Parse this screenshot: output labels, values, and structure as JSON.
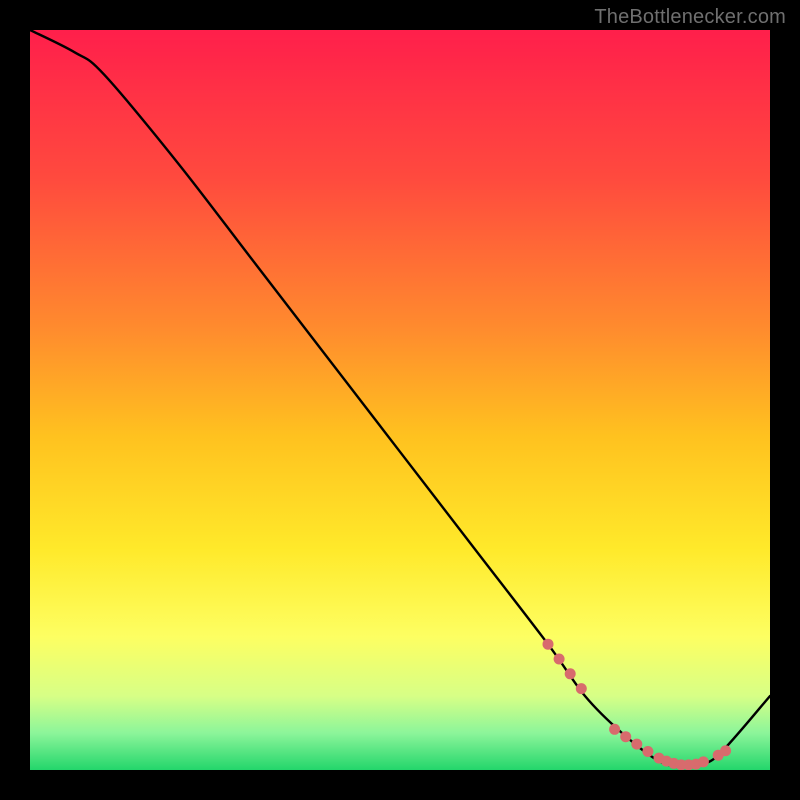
{
  "attribution": "TheBottlenecker.com",
  "chart_data": {
    "type": "line",
    "title": "",
    "xlabel": "",
    "ylabel": "",
    "xlim": [
      0,
      100
    ],
    "ylim": [
      0,
      100
    ],
    "series": [
      {
        "name": "curve",
        "x": [
          0,
          6,
          10,
          20,
          30,
          40,
          50,
          60,
          70,
          75,
          80,
          85,
          88,
          90,
          93,
          100
        ],
        "y": [
          100,
          97,
          94,
          82,
          69,
          56,
          43,
          30,
          17,
          10,
          5,
          1.2,
          0.5,
          0.8,
          2,
          10
        ]
      }
    ],
    "markers": {
      "name": "highlight-dots",
      "color": "#d86b6d",
      "x": [
        70,
        71.5,
        73,
        74.5,
        79,
        80.5,
        82,
        83.5,
        85,
        86,
        87,
        88,
        89,
        90,
        91,
        93,
        94
      ],
      "y": [
        17,
        15,
        13,
        11,
        5.5,
        4.5,
        3.5,
        2.5,
        1.6,
        1.2,
        0.9,
        0.7,
        0.7,
        0.8,
        1.1,
        2,
        2.6
      ]
    },
    "gradient_stops": [
      {
        "offset": 0.0,
        "color": "#ff1f4b"
      },
      {
        "offset": 0.2,
        "color": "#ff4a3e"
      },
      {
        "offset": 0.4,
        "color": "#ff8a2e"
      },
      {
        "offset": 0.55,
        "color": "#ffc21f"
      },
      {
        "offset": 0.7,
        "color": "#ffe92a"
      },
      {
        "offset": 0.82,
        "color": "#fdff62"
      },
      {
        "offset": 0.9,
        "color": "#d7ff86"
      },
      {
        "offset": 0.95,
        "color": "#8cf59a"
      },
      {
        "offset": 1.0,
        "color": "#23d66b"
      }
    ]
  }
}
